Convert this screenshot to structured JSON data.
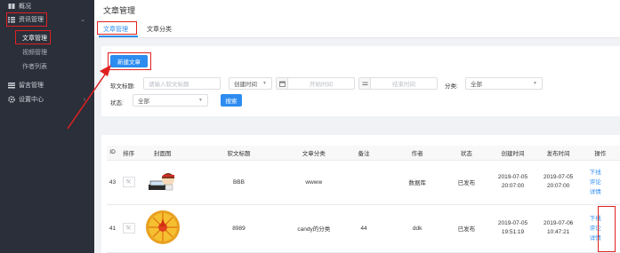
{
  "sidebar": {
    "overview": "概况",
    "news_mgmt": "资讯管理",
    "article_mgmt": "文章管理",
    "video_mgmt": "视频管理",
    "author_list": "作者列表",
    "comment_mgmt": "留言管理",
    "settings": "设置中心"
  },
  "header": {
    "title": "文章管理",
    "tabs": [
      "文章管理",
      "文章分类"
    ]
  },
  "toolbar": {
    "create_button": "新建文章"
  },
  "filters": {
    "title_label": "软文标题:",
    "title_placeholder": "请输入软文标题",
    "time_select": "创建时间",
    "start_time": "开始时间",
    "end_time": "结束时间",
    "category_label": "分类:",
    "category_value": "全部",
    "status_label": "状态:",
    "status_value": "全部",
    "search_button": "搜索"
  },
  "table": {
    "headers": [
      "ID",
      "排序",
      "封面图",
      "软文标题",
      "文章分类",
      "备注",
      "作者",
      "状态",
      "创建时间",
      "发布时间",
      "操作"
    ],
    "rows": [
      {
        "id": "43",
        "sort": "5(",
        "title": "BBB",
        "category": "wwww",
        "note": "",
        "author": "数据库",
        "status": "已发布",
        "created": "2019-07-05 20:07:00",
        "published": "2019-07-05 20:07:00",
        "actions": [
          "下线",
          "评论",
          "详情"
        ]
      },
      {
        "id": "41",
        "sort": "5(",
        "title": "8989",
        "category": "candy的分类",
        "note": "44",
        "author": "ddk",
        "status": "已发布",
        "created": "2019-07-05 19:51:19",
        "published": "2019-07-06 10:47:21",
        "actions": [
          "下线",
          "评论",
          "详情"
        ]
      }
    ]
  }
}
